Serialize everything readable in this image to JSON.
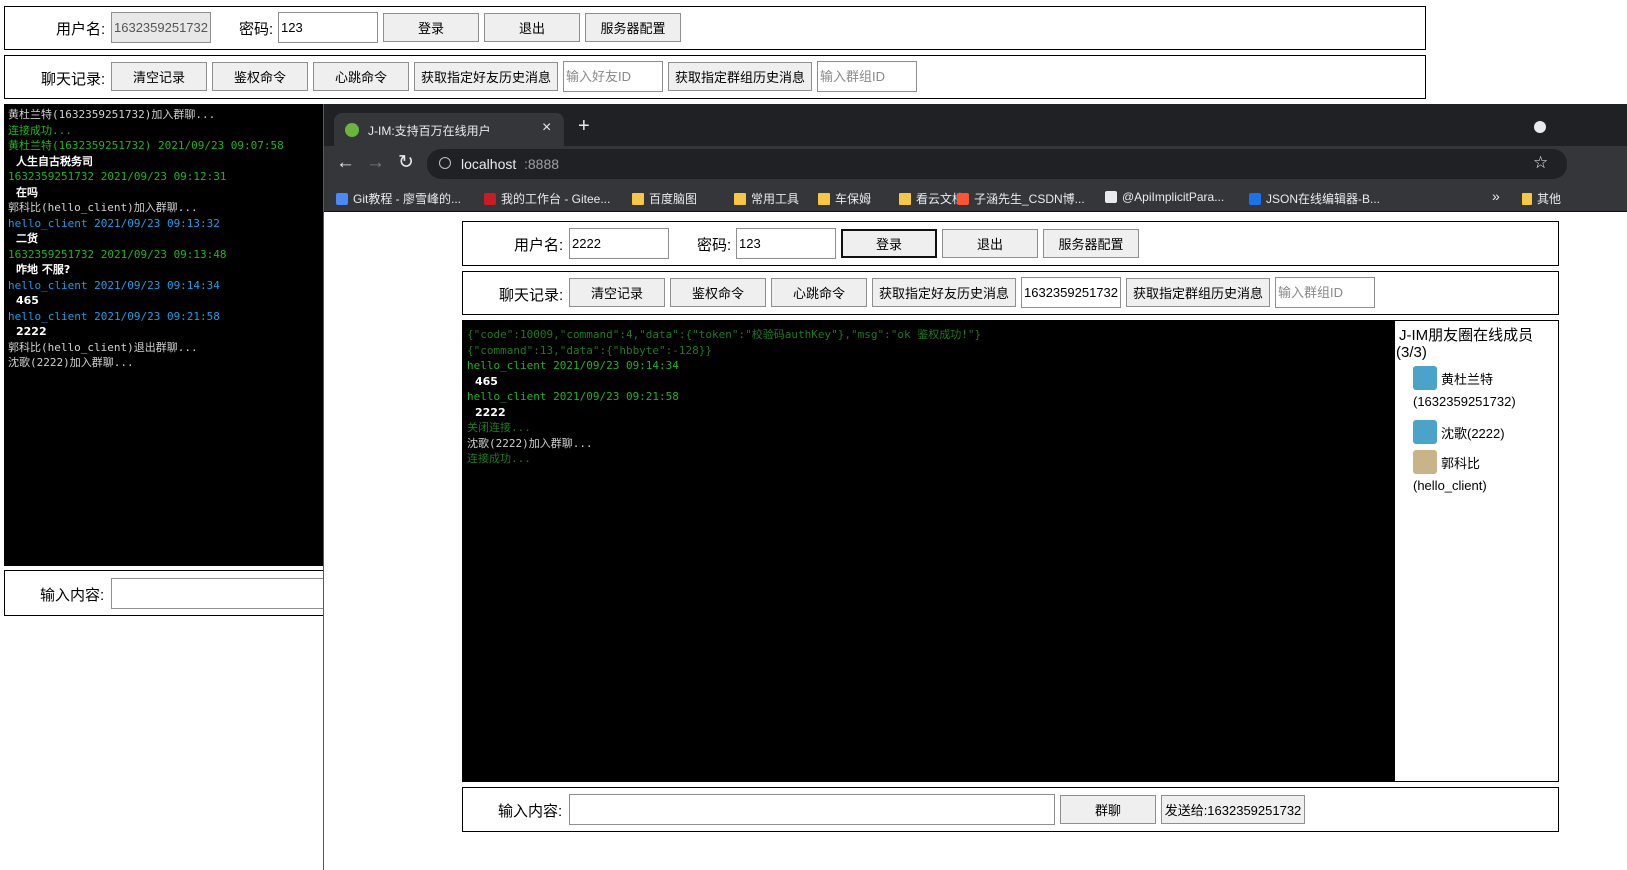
{
  "left_client": {
    "login": {
      "username_label": "用户名:",
      "username_value": "1632359251732",
      "password_label": "密码:",
      "password_value": "123",
      "login_button": "登录",
      "logout_button": "退出",
      "server_config_button": "服务器配置"
    },
    "toolbar": {
      "label": "聊天记录:",
      "clear_button": "清空记录",
      "auth_button": "鉴权命令",
      "heartbeat_button": "心跳命令",
      "friend_history_button": "获取指定好友历史消息",
      "friend_id_placeholder": "输入好友ID",
      "group_history_button": "获取指定群组历史消息",
      "group_id_placeholder": "输入群组ID"
    },
    "log": [
      {
        "text": "黄杜兰特(1632359251732)加入群聊...",
        "style": "gray"
      },
      {
        "text": "连接成功...",
        "style": "green"
      },
      {
        "text": "黄杜兰特(1632359251732) 2021/09/23 09:07:58",
        "style": "green"
      },
      {
        "text": "人生自古税务司",
        "style": "msg"
      },
      {
        "text": "1632359251732 2021/09/23 09:12:31",
        "style": "green"
      },
      {
        "text": "在吗",
        "style": "msg"
      },
      {
        "text": "郭科比(hello_client)加入群聊...",
        "style": "gray"
      },
      {
        "text": "hello_client 2021/09/23 09:13:32",
        "style": "lblue"
      },
      {
        "text": "二货",
        "style": "msg"
      },
      {
        "text": "1632359251732 2021/09/23 09:13:48",
        "style": "green"
      },
      {
        "text": "咋地 不服?",
        "style": "msg"
      },
      {
        "text": "hello_client 2021/09/23 09:14:34",
        "style": "lblue"
      },
      {
        "text": "465",
        "style": "msg"
      },
      {
        "text": "hello_client 2021/09/23 09:21:58",
        "style": "lblue"
      },
      {
        "text": "2222",
        "style": "msg"
      },
      {
        "text": "郭科比(hello_client)退出群聊...",
        "style": "gray"
      },
      {
        "text": "沈歌(2222)加入群聊...",
        "style": "gray"
      }
    ],
    "input": {
      "label": "输入内容:",
      "value": ""
    }
  },
  "browser": {
    "tab_title": "J-IM:支持百万在线用户",
    "tab_close": "×",
    "new_tab": "+",
    "url_host": "localhost",
    "url_port": ":8888",
    "bookmarks": [
      {
        "label": "Git教程 - 廖雪峰的...",
        "icon": "rocket-icon",
        "color": "#4a8af4"
      },
      {
        "label": "我的工作台 - Gitee...",
        "icon": "gitee-icon",
        "color": "#c71d23"
      },
      {
        "label": "百度脑图",
        "icon": "folder-icon",
        "color": "#f6c744"
      },
      {
        "label": "常用工具",
        "icon": "folder-icon",
        "color": "#f6c744"
      },
      {
        "label": "车保姆",
        "icon": "folder-icon",
        "color": "#f6c744"
      },
      {
        "label": "看云文档",
        "icon": "folder-icon",
        "color": "#f6c744"
      },
      {
        "label": "子涵先生_CSDN博...",
        "icon": "csdn-icon",
        "color": "#fc5531"
      },
      {
        "label": "@ApiImplicitPara...",
        "icon": "om-icon",
        "color": "#e8eaed"
      },
      {
        "label": "JSON在线编辑器-B...",
        "icon": "bejson-icon",
        "color": "#1a73e8"
      }
    ],
    "more_bookmarks": "»",
    "other_bookmarks": "其他"
  },
  "right_client": {
    "login": {
      "username_label": "用户名:",
      "username_value": "2222",
      "password_label": "密码:",
      "password_value": "123",
      "login_button": "登录",
      "logout_button": "退出",
      "server_config_button": "服务器配置"
    },
    "toolbar": {
      "label": "聊天记录:",
      "clear_button": "清空记录",
      "auth_button": "鉴权命令",
      "heartbeat_button": "心跳命令",
      "friend_history_button": "获取指定好友历史消息",
      "friend_id_value": "1632359251732",
      "group_history_button": "获取指定群组历史消息",
      "group_id_placeholder": "输入群组ID"
    },
    "log": [
      {
        "text": "{\"code\":10009,\"command\":4,\"data\":{\"token\":\"校验码authKey\"},\"msg\":\"ok 鉴权成功!\"}",
        "style": "dgreen"
      },
      {
        "text": "{\"command\":13,\"data\":{\"hbbyte\":-128}}",
        "style": "dgreen"
      },
      {
        "text": "hello_client 2021/09/23 09:14:34",
        "style": "green"
      },
      {
        "text": "465",
        "style": "msg"
      },
      {
        "text": "hello_client 2021/09/23 09:21:58",
        "style": "green"
      },
      {
        "text": "2222",
        "style": "msg"
      },
      {
        "text": "关闭连接...",
        "style": "dgreen"
      },
      {
        "text": "沈歌(2222)加入群聊...",
        "style": "gray"
      },
      {
        "text": "连接成功...",
        "style": "dgreen"
      }
    ],
    "online": {
      "title": "J-IM朋友圈在线成员",
      "count": "(3/3)",
      "members": [
        {
          "name": "黄杜兰特",
          "id": "(1632359251732)",
          "avatar": "404-avatar-icon"
        },
        {
          "name": "沈歌(2222)",
          "id": "",
          "avatar": "404-avatar-icon"
        },
        {
          "name": "郭科比",
          "id": "(hello_client)",
          "avatar": "photo-avatar-icon"
        }
      ]
    },
    "input": {
      "label": "输入内容:",
      "value": "",
      "group_chat_button": "群聊",
      "send_to_button": "发送给:1632359251732"
    }
  }
}
